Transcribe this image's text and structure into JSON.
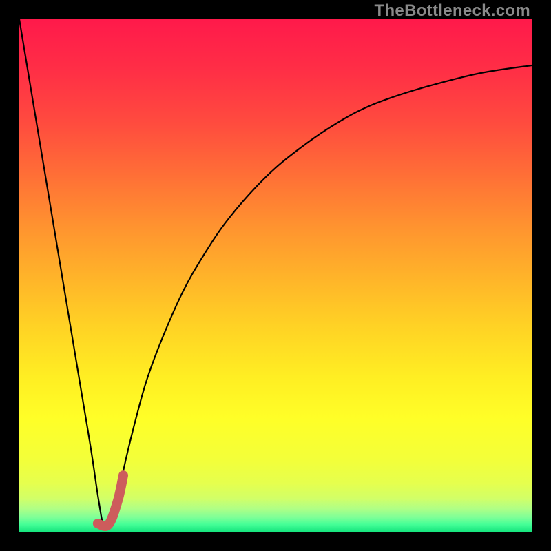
{
  "watermark": "TheBottleneck.com",
  "gradient": {
    "stops": [
      {
        "offset": 0.0,
        "color": "#ff1a4b"
      },
      {
        "offset": 0.1,
        "color": "#ff2f46"
      },
      {
        "offset": 0.2,
        "color": "#ff4b3f"
      },
      {
        "offset": 0.3,
        "color": "#ff6e37"
      },
      {
        "offset": 0.4,
        "color": "#ff9230"
      },
      {
        "offset": 0.5,
        "color": "#ffb32a"
      },
      {
        "offset": 0.6,
        "color": "#ffd325"
      },
      {
        "offset": 0.7,
        "color": "#ffef23"
      },
      {
        "offset": 0.78,
        "color": "#ffff28"
      },
      {
        "offset": 0.86,
        "color": "#f3ff3a"
      },
      {
        "offset": 0.905,
        "color": "#e6ff4e"
      },
      {
        "offset": 0.935,
        "color": "#d2ff68"
      },
      {
        "offset": 0.955,
        "color": "#b0ff86"
      },
      {
        "offset": 0.972,
        "color": "#7eff98"
      },
      {
        "offset": 0.986,
        "color": "#44ff97"
      },
      {
        "offset": 1.0,
        "color": "#16e57e"
      }
    ]
  },
  "chart_data": {
    "type": "line",
    "title": "",
    "xlabel": "",
    "ylabel": "",
    "xlim": [
      0,
      100
    ],
    "ylim": [
      0,
      100
    ],
    "series": [
      {
        "name": "bottleneck-curve",
        "color": "#000000",
        "width": 2.2,
        "x": [
          0,
          2,
          4,
          6,
          8,
          10,
          12,
          14,
          15.5,
          16.5,
          17.8,
          19,
          21,
          23,
          25,
          28,
          32,
          36,
          40,
          45,
          50,
          55,
          60,
          66,
          72,
          80,
          90,
          100
        ],
        "y": [
          100,
          88,
          76,
          64,
          52,
          40,
          28,
          16,
          6,
          1.2,
          1.5,
          6,
          15,
          23,
          30,
          38,
          47,
          54,
          60,
          66,
          71,
          75,
          78.5,
          82,
          84.5,
          87,
          89.5,
          91
        ]
      },
      {
        "name": "highlight-stub",
        "color": "#cd5c5c",
        "width": 14,
        "linecap": "round",
        "x": [
          15.3,
          17.4,
          19.2,
          20.3
        ],
        "y": [
          1.6,
          1.4,
          6.0,
          11.0
        ]
      }
    ]
  }
}
